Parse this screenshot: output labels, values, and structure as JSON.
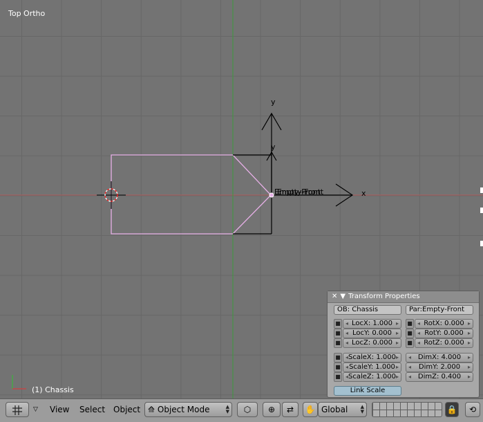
{
  "viewport": {
    "title": "Top Ortho",
    "object_info": "(1) Chassis",
    "labels": {
      "axis_y_top": "y",
      "axis_y_mid": "y",
      "axis_x": "x",
      "empty_name": "Empty-Front",
      "empty_name_overlap": "Empty-Front"
    }
  },
  "transform_panel": {
    "title": "Transform Properties",
    "ob": "OB: Chassis",
    "par": "Par:Empty-Front",
    "loc": [
      "LocX: 1.000",
      "LocY: 0.000",
      "LocZ: 0.000"
    ],
    "rot": [
      "RotX: 0.000",
      "RotY: 0.000",
      "RotZ: 0.000"
    ],
    "scale": [
      "ScaleX: 1.000",
      "ScaleY: 1.000",
      "ScaleZ: 1.000"
    ],
    "dim": [
      "DimX: 4.000",
      "DimY: 2.000",
      "DimZ: 0.400"
    ],
    "link_scale": "Link Scale"
  },
  "toolbar": {
    "menus": [
      "View",
      "Select",
      "Object"
    ],
    "mode": "Object Mode",
    "orientation": "Global"
  },
  "colors": {
    "mesh_outline": "#e8b0e8",
    "x_axis": "#c05050",
    "y_axis": "#40a040"
  }
}
